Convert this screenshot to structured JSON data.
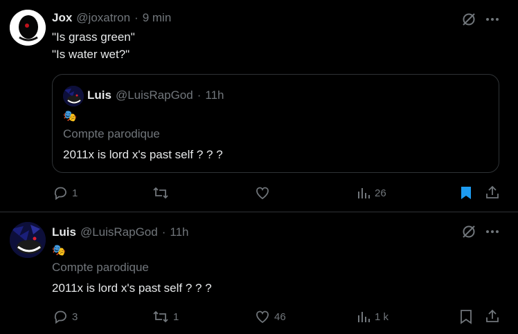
{
  "tweet1": {
    "name": "Jox",
    "handle": "@joxatron",
    "dot": "·",
    "time": "9 min",
    "lines": [
      "\"Is grass green\"",
      "\"Is water wet?\""
    ],
    "quote": {
      "name": "Luis",
      "handle": "@LuisRapGod",
      "dot": "·",
      "time": "11h",
      "badge_emoji": "🎭",
      "label": "Compte parodique",
      "text": "2011x is lord x's past self ? ? ?"
    },
    "actions": {
      "replies": "1",
      "reposts": "",
      "likes": "",
      "views": "26"
    },
    "colors": {
      "bookmark_active": "#1d9bf0"
    }
  },
  "tweet2": {
    "name": "Luis",
    "handle": "@LuisRapGod",
    "dot": "·",
    "time": "11h",
    "badge_emoji": "🎭",
    "label": "Compte parodique",
    "text": "2011x is lord x's past self ? ? ?",
    "actions": {
      "replies": "3",
      "reposts": "1",
      "likes": "46",
      "views": "1 k"
    }
  },
  "icons": [
    "grok-icon",
    "more-icon",
    "reply-icon",
    "repost-icon",
    "like-icon",
    "views-icon",
    "bookmark-icon",
    "share-icon"
  ]
}
